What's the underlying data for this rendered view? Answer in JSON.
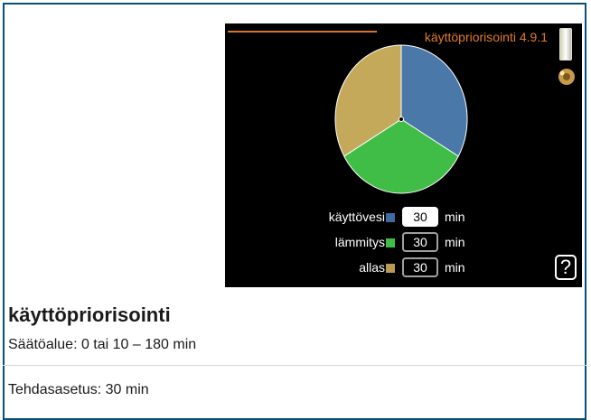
{
  "screen": {
    "title": "käyttöpriorisointi 4.9.1",
    "help_glyph": "?",
    "icons": {
      "thermometer": "thermometer-icon",
      "settings": "gear-icon",
      "help": "help-icon"
    }
  },
  "chart_data": {
    "type": "pie",
    "values": [
      30,
      30,
      30
    ],
    "categories": [
      "käyttövesi",
      "lämmitys",
      "allas"
    ],
    "colors": [
      "#4a78a8",
      "#3fbd47",
      "#c4a95a"
    ]
  },
  "rows": [
    {
      "label": "käyttövesi",
      "value": "30",
      "unit": "min",
      "selected": true,
      "color": "#3d6aa0"
    },
    {
      "label": "lämmitys",
      "value": "30",
      "unit": "min",
      "selected": false,
      "color": "#3fbd47"
    },
    {
      "label": "allas",
      "value": "30",
      "unit": "min",
      "selected": false,
      "color": "#b89a50"
    }
  ],
  "doc": {
    "heading": "käyttöpriorisointi",
    "range": "Säätöalue: 0 tai 10 – 180 min",
    "factory": "Tehdasasetus: 30 min"
  }
}
